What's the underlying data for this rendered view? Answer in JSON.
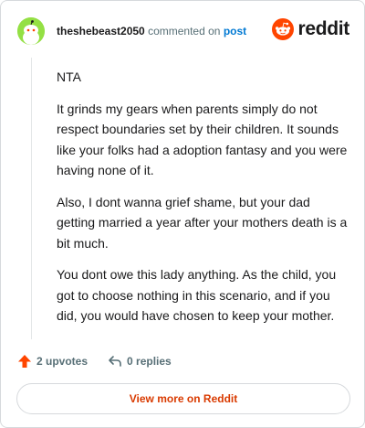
{
  "header": {
    "username": "theshebeast2050",
    "action_text": "commented on",
    "post_link": "post",
    "brand": "reddit"
  },
  "comment": {
    "paragraphs": [
      "NTA",
      "It grinds my gears when parents simply do not respect boundaries set by their children. It sounds like your folks had a adoption fantasy and you were having none of it.",
      "Also, I dont wanna grief shame, but your dad getting married a year after your mothers death is a bit much.",
      "You dont owe this lady anything. As the child, you got to choose nothing in this scenario, and if you did, you would have chosen to keep your mother."
    ]
  },
  "actions": {
    "upvotes": "2 upvotes",
    "replies": "0 replies"
  },
  "footer": {
    "view_more": "View more on Reddit"
  },
  "colors": {
    "avatar": "#94e044",
    "brand_orange": "#ff4500",
    "link_blue": "#0079d3",
    "view_more": "#d93a00"
  }
}
